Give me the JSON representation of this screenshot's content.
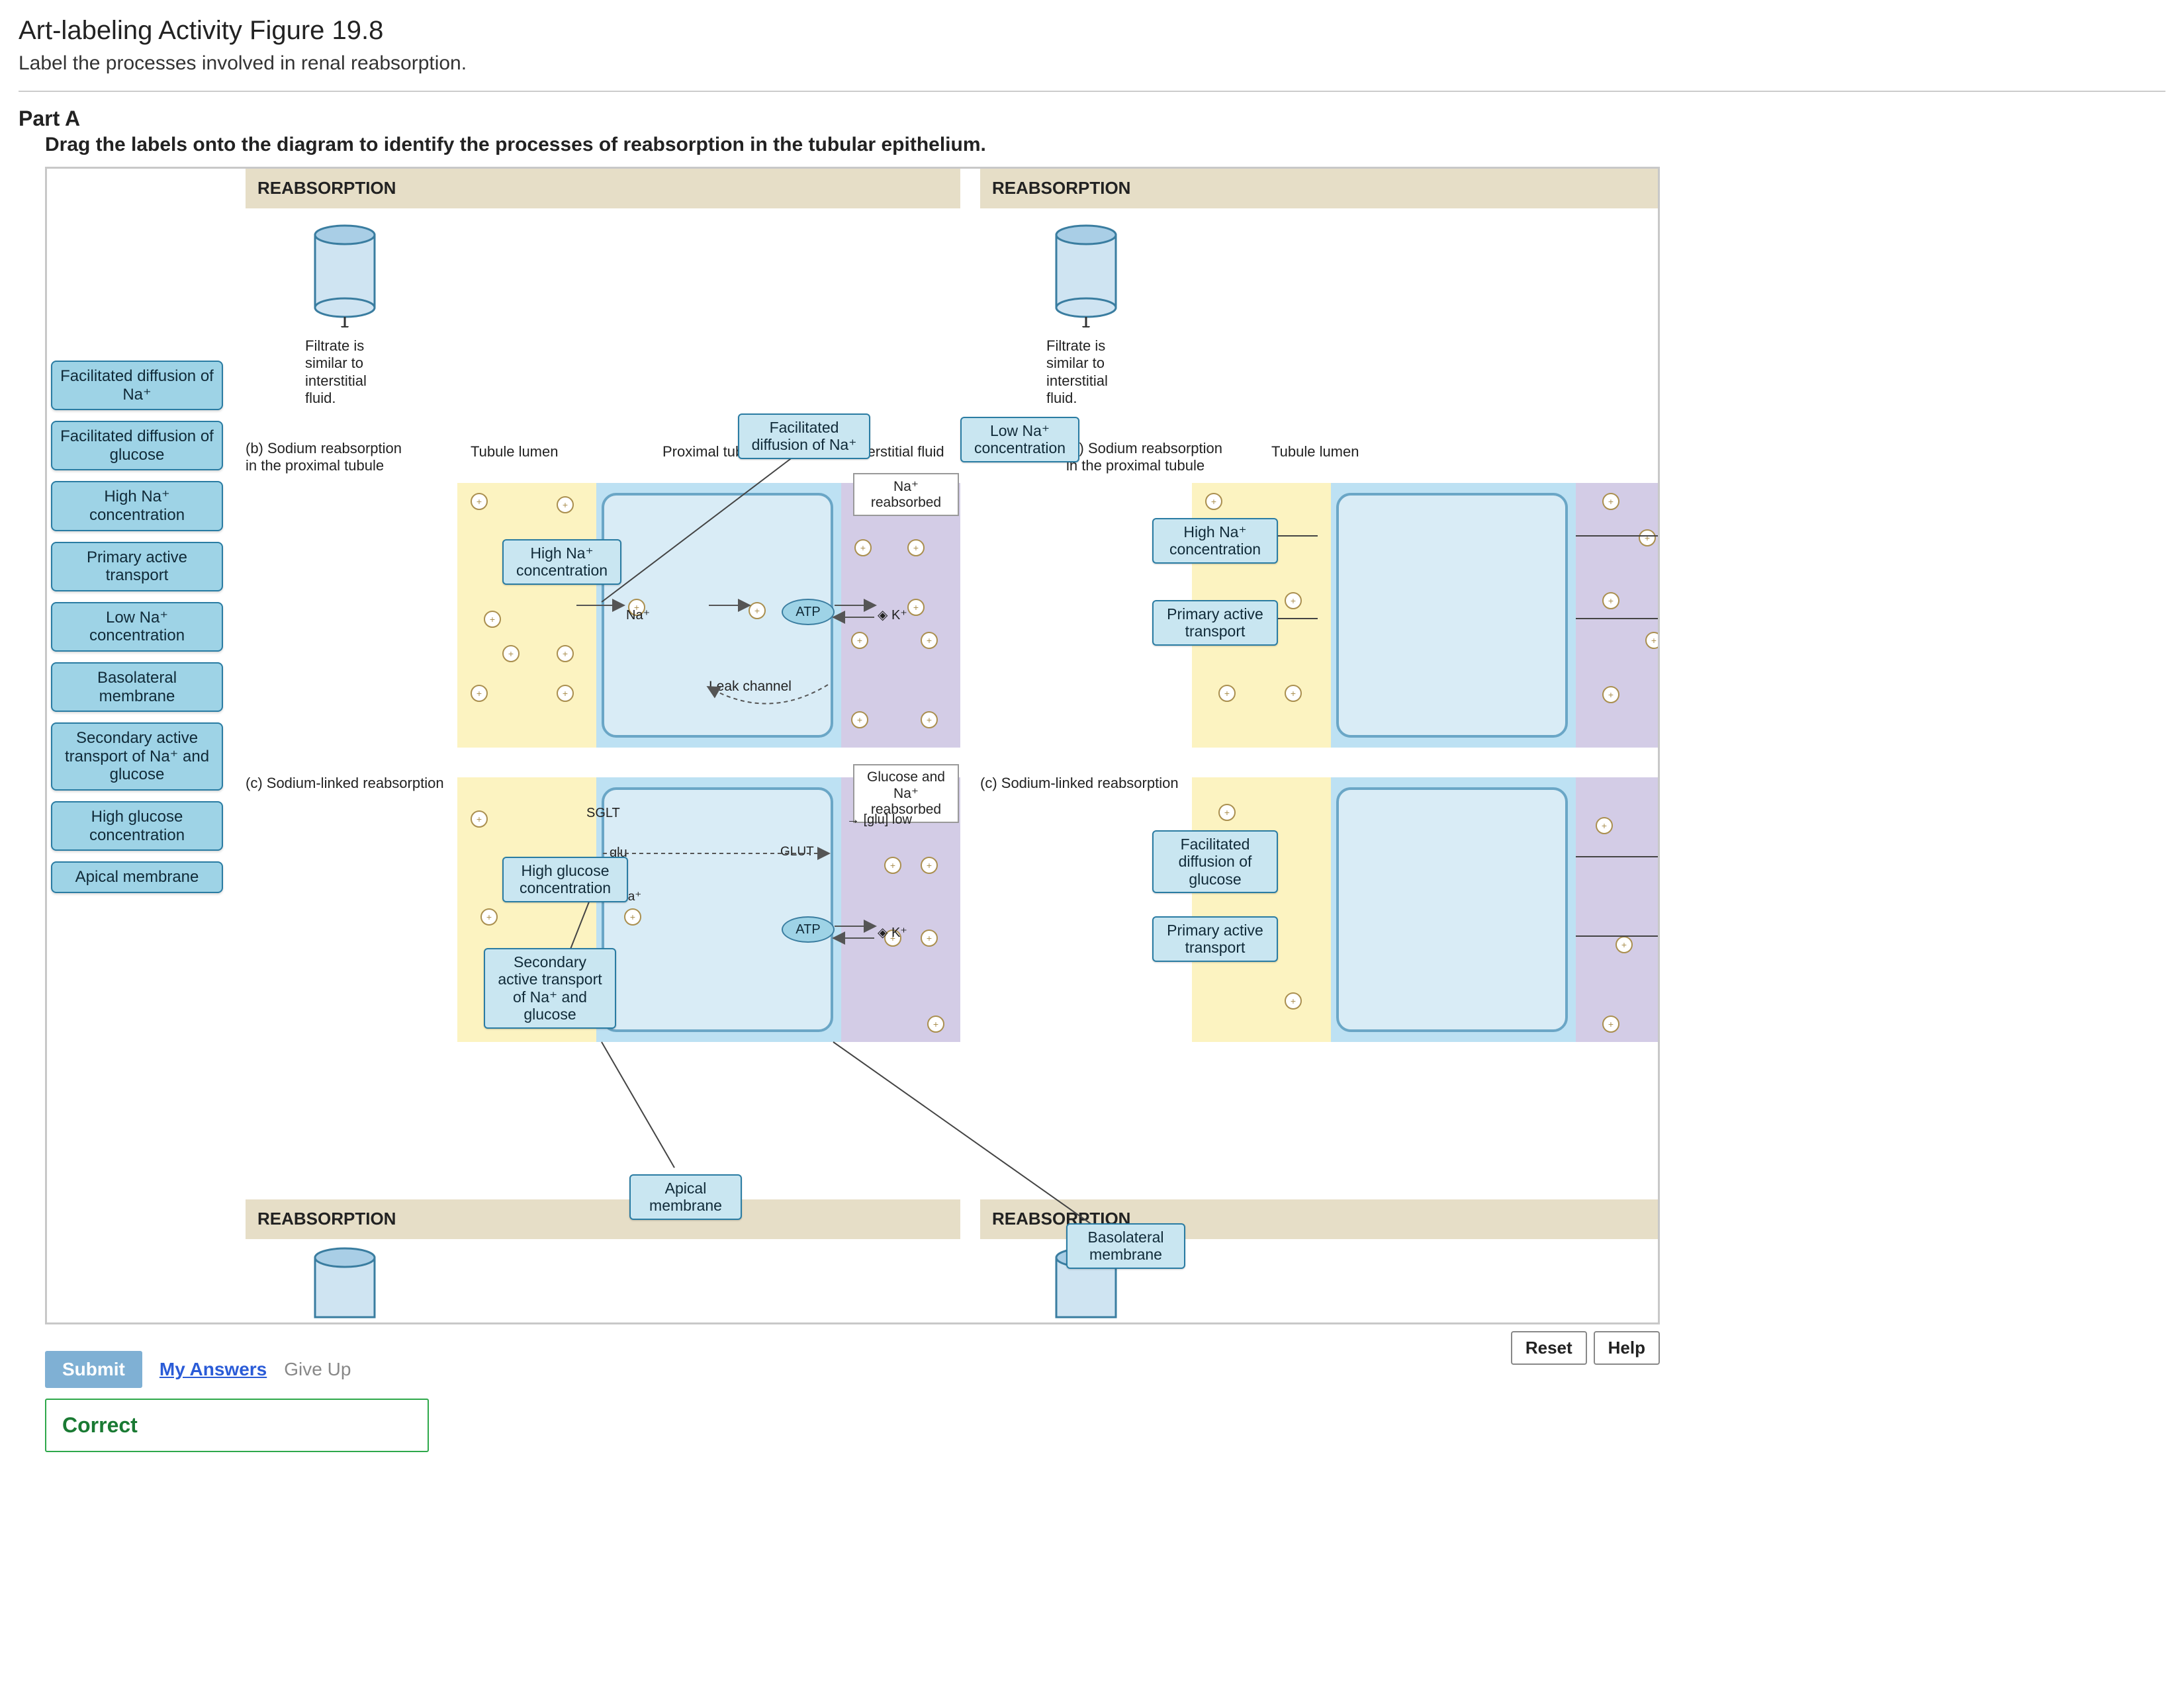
{
  "page": {
    "title": "Art-labeling Activity Figure 19.8",
    "subtitle": "Label the processes involved in renal reabsorption.",
    "part_label": "Part A",
    "instruction": "Drag the labels onto the diagram to identify the processes of reabsorption in the tubular epithelium."
  },
  "palette": [
    "Facilitated\ndiffusion of Na⁺",
    "Facilitated\ndiffusion of\nglucose",
    "High Na⁺\nconcentration",
    "Primary active\ntransport",
    "Low Na⁺\nconcentration",
    "Basolateral\nmembrane",
    "Secondary\nactive transport\nof Na⁺ and\nglucose",
    "High glucose\nconcentration",
    "Apical\nmembrane"
  ],
  "headers": {
    "reabs_top_left": "REABSORPTION",
    "reabs_top_right": "REABSORPTION",
    "reabs_bottom_left": "REABSORPTION",
    "reabs_bottom_right": "REABSORPTION"
  },
  "static": {
    "filtrate_left": "Filtrate is\nsimilar to\ninterstitial\nfluid.",
    "filtrate_right": "Filtrate is\nsimilar to\ninterstitial\nfluid.",
    "caption_b_left": "(b) Sodium reabsorption\nin the proximal tubule",
    "caption_b_right": "(b) Sodium reabsorption\nin the proximal tubule",
    "tubule_lumen_left": "Tubule lumen",
    "tubule_lumen_right": "Tubule lumen",
    "proximal_tubule": "Proximal tubule cell",
    "interstitial_fluid": "Interstitial fluid",
    "na_reabsorbed": "Na⁺ reabsorbed",
    "na_symbol": "Na⁺",
    "k_symbol": "K⁺",
    "atp": "ATP",
    "leak_channel": "Leak channel",
    "caption_c_left": "(c) Sodium-linked reabsorption",
    "caption_c_right": "(c) Sodium-linked reabsorption",
    "glucose_na_reabs": "Glucose and Na⁺\nreabsorbed",
    "glu_low": "[glu] low",
    "sglt": "SGLT",
    "glu_label": "glu",
    "glut_label": "GLUT"
  },
  "placed": {
    "facilitated_na": "Facilitated\ndiffusion of Na⁺",
    "low_na": "Low Na⁺\nconcentration",
    "high_na_left": "High Na⁺\nconcentration",
    "high_na_right": "High Na⁺\nconcentration",
    "primary_active_right1": "Primary active\ntransport",
    "high_glucose": "High glucose\nconcentration",
    "secondary_active": "Secondary\nactive transport\nof Na⁺ and\nglucose",
    "apical_membrane": "Apical\nmembrane",
    "basolateral_membrane": "Basolateral\nmembrane",
    "facilitated_glucose_right": "Facilitated\ndiffusion of\nglucose",
    "primary_active_right2": "Primary active\ntransport"
  },
  "controls": {
    "reset": "Reset",
    "help": "Help",
    "submit": "Submit",
    "my_answers": "My Answers",
    "give_up": "Give Up",
    "correct": "Correct"
  }
}
